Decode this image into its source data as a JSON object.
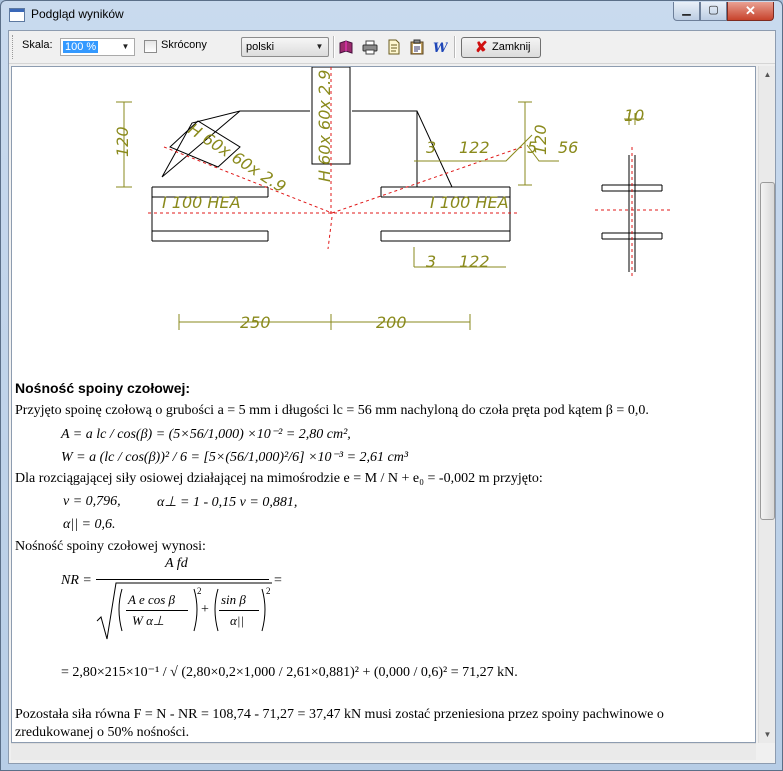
{
  "window": {
    "title": "Podgląd wyników",
    "controls": {
      "minimize": "▁",
      "maximize": "▢",
      "close": "✕"
    }
  },
  "toolbar": {
    "scale_label": "Skala:",
    "scale_value": "100 %",
    "abbreviated_label": "Skrócony",
    "abbreviated_checked": false,
    "language_value": "polski",
    "icons": [
      "book-icon",
      "printer-icon",
      "document-icon",
      "clipboard-icon",
      "word-icon"
    ],
    "close_label": "Zamknij"
  },
  "drawing": {
    "dims": {
      "left_height": "120",
      "brace_left": "H 60x 60x 2.9",
      "brace_center": "H 60x 60x 2.9",
      "beam_left": "I 100 HEA",
      "beam_right": "I 100 HEA",
      "weld_top_a": "3",
      "weld_top_l": "122",
      "weld_bottom_a": "3",
      "weld_bottom_l": "122",
      "right_120": "120",
      "weld_5": "5",
      "weld_56": "56",
      "section_10": "10",
      "span_left": "250",
      "span_right": "200"
    }
  },
  "report": {
    "heading": "Nośność spoiny czołowej:",
    "line1": "Przyjęto spoinę czołową o grubości  a = 5 mm i długości  lc = 56 mm nachyloną do czoła pręta pod kątem β = 0,0.",
    "eq_A": "A = a lc / cos(β) = (5×56/1,000) ×10⁻² = 2,80 cm²,",
    "eq_W": "W = a (lc / cos(β))² / 6 = [5×(56/1,000)²/6] ×10⁻³ = 2,61 cm³",
    "line2": "Dla rozciągającej siły osiowej działającej na mimośrodzie  e = M / N + e₀ = -0,002 m przyjęto:",
    "nu": "ν = 0,796,",
    "alpha_perp": "α⊥ = 1 - 0,15  ν = 0,881,",
    "alpha_par": "α|| = 0,6.",
    "line3": "Nośność spoiny czołowej wynosi:",
    "formula": {
      "lhs": "NR =",
      "numerator": "A fd",
      "term1_num": "A e cos β",
      "term1_den": "W α⊥",
      "plus": "+",
      "term2_num": "sin β",
      "term2_den": "α||",
      "sq": "2",
      "eq": "="
    },
    "result": "= 2,80×215×10⁻¹  / √ (2,80×0,2×1,000 / 2,61×0,881)² + (0,000 / 0,6)²  = 71,27 kN.",
    "line4": "Pozostała siła równa  F = N - NR = 108,74 - 71,27 = 37,47 kN musi zostać przeniesiona przez spoiny pachwinowe o",
    "line5": "zredukowanej o 50% nośności."
  }
}
